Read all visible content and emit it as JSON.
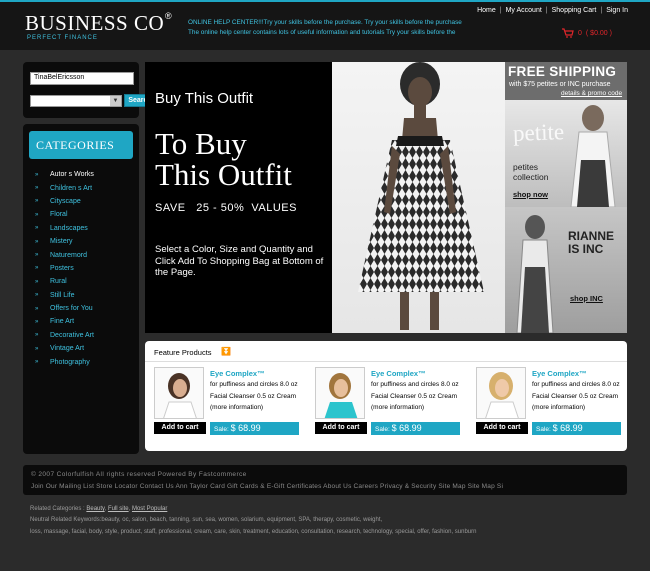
{
  "header": {
    "logo": "BUSINESS CO",
    "logo_mark": "®",
    "tagline": "PERFECT FINANCE",
    "help_line1": "ONLINE HELP CENTER!!!Try your skills before the purchase. Try your skills before the purchase",
    "help_line2": "The online help center contains lots of useful information and tutorials Try your skills before the",
    "nav": [
      "Home",
      "My Account",
      "Shopping Cart",
      "Sign In"
    ],
    "cart_count": "0",
    "cart_total": "( $0.00 )"
  },
  "search": {
    "value": "TinaBelEricsson",
    "button": "Search"
  },
  "categories": {
    "title": "CATEGORIES",
    "items": [
      "Autor s Works",
      "Children s Art",
      "Cityscape",
      "Floral",
      "Landscapes",
      "Mistery",
      "Naturemord",
      "Posters",
      "Rural",
      "Still Life",
      "Offers for You",
      "Fine Art",
      "Decorative Art",
      "Vintage Art",
      "Photography"
    ]
  },
  "banner": {
    "small": "Buy This Outfit",
    "big1": "To Buy",
    "big2": "This Outfit",
    "save": "SAVE   25 - 50%  VALUES",
    "select": "Select a Color, Size and Quantity and Click Add To Shopping Bag at Bottom of the Page."
  },
  "ad": {
    "free": "FREE SHIPPING",
    "sub": "with $75 petites or INC purchase",
    "details": "details & promo code",
    "petite": "petite",
    "petites_collection": "petites collection",
    "shop_now": "shop now",
    "rianne": "RIANNE IS INC",
    "shop_inc": "shop INC"
  },
  "featured": {
    "title": "Feature  Products",
    "products": [
      {
        "title": "Eye Complex™",
        "d1": "for puffiness and circles 8.0 oz",
        "d2": "Facial Cleanser 0.5 oz Cream",
        "more": "(more information)",
        "add": "Add to cart",
        "sale_label": "Sale:",
        "price": "$ 68.99"
      },
      {
        "title": "Eye Complex™",
        "d1": "for puffiness and circles 8.0 oz",
        "d2": "Facial Cleanser 0.5 oz Cream",
        "more": "(more information)",
        "add": "Add to cart",
        "sale_label": "Sale:",
        "price": "$ 68.99"
      },
      {
        "title": "Eye Complex™",
        "d1": "for puffiness and circles 8.0 oz",
        "d2": "Facial Cleanser 0.5 oz Cream",
        "more": "(more information)",
        "add": "Add to cart",
        "sale_label": "Sale:",
        "price": "$ 68.99"
      }
    ]
  },
  "footer": {
    "copyright": "© 2007 Colorfulfish All rights reserved Powered  By Fastcommerce",
    "links": "Join Our Mailing List  Store Locator Contact Us Ann Taylor Card Gift Cards & E-Gift Certificates About Us Careers Privacy & Security Site Map Site Map Si",
    "related_label": "Related Categories :",
    "related_links": [
      "Beauty",
      "Full site",
      "Most Popular"
    ],
    "keywords_line1": "Neutral  Related Keywords:beauty, oc, salon, beach, tanning, sun, sea, women, solarium, equipment, SPA, therapy, cosmetic, weight,",
    "keywords_line2": "loss, massage, facial, body, style, product, staff, professional, cream, care, skin, treatment, education, consultation, research, technology, special, offer, fashion, sunburn"
  },
  "colors": {
    "accent": "#1fa6c4",
    "background": "#2b2b2b",
    "panel": "#0b0b0b",
    "cart_red": "#e1262b"
  }
}
